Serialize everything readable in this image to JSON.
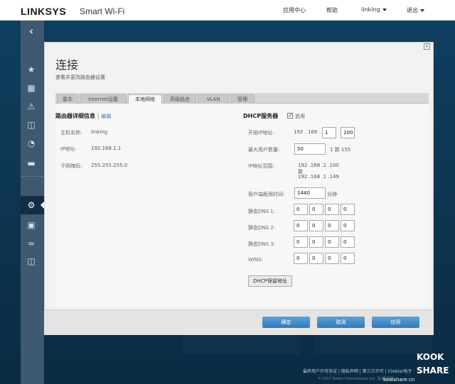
{
  "header": {
    "brand": "LINKSYS",
    "product": "Smart Wi-Fi",
    "nav": [
      "应用中心",
      "帮助",
      "linking",
      "退出"
    ]
  },
  "page": {
    "title": "连接",
    "subtitle": "查看并更改路由器设置"
  },
  "tabs": [
    "基本",
    "Internet设置",
    "本地网络",
    "高级路由",
    "VLAN",
    "管理"
  ],
  "active_tab": "本地网络",
  "router_details": {
    "title": "路由器详细信息",
    "edit": "编辑",
    "host_name_label": "主机名称:",
    "host_name": "linking",
    "ip_label": "IP地址:",
    "ip": "192.168.1.1",
    "mask_label": "子网掩码:",
    "mask": "255.255.255.0"
  },
  "dhcp": {
    "title": "DHCP服务器",
    "enabled_label": "启用",
    "enabled_mark": "✓",
    "start_ip_label": "开始IP地址:",
    "start_ip": [
      "192",
      "168",
      "1",
      "100"
    ],
    "max_users_label": "最大用户数量:",
    "max_users": "50",
    "max_users_range": "1 致 155",
    "ip_range_label": "IP地址范围:",
    "ip_range_from": "192 .168 .1 .100",
    "ip_range_to_label": "致",
    "ip_range_to": "192 .168 .1 .149",
    "lease_label": "客户端租用时间:",
    "lease": "1440",
    "lease_unit": "分钟",
    "dns1_label": "静态DNS 1:",
    "dns2_label": "静态DNS 2:",
    "dns3_label": "静态DNS 3:",
    "wins_label": "WINS:",
    "octet": "0",
    "reservation_button": "DHCP保留地址"
  },
  "buttons": {
    "ok": "确定",
    "cancel": "取消",
    "apply": "应用"
  },
  "footer": {
    "links": "最终用户许可协议 | 隐私声明 | 第三方许可 | (Ookla)电子",
    "copyright": "© 2017 Belkin International, Inc. 及/或关联"
  },
  "watermark": {
    "line1": "KOOK",
    "line2": "SHARE",
    "site": "koolshare.cn"
  },
  "colors": {
    "accent": "#3a7fc0",
    "sidebar": "#3f5a70",
    "background": "#0d3550"
  }
}
